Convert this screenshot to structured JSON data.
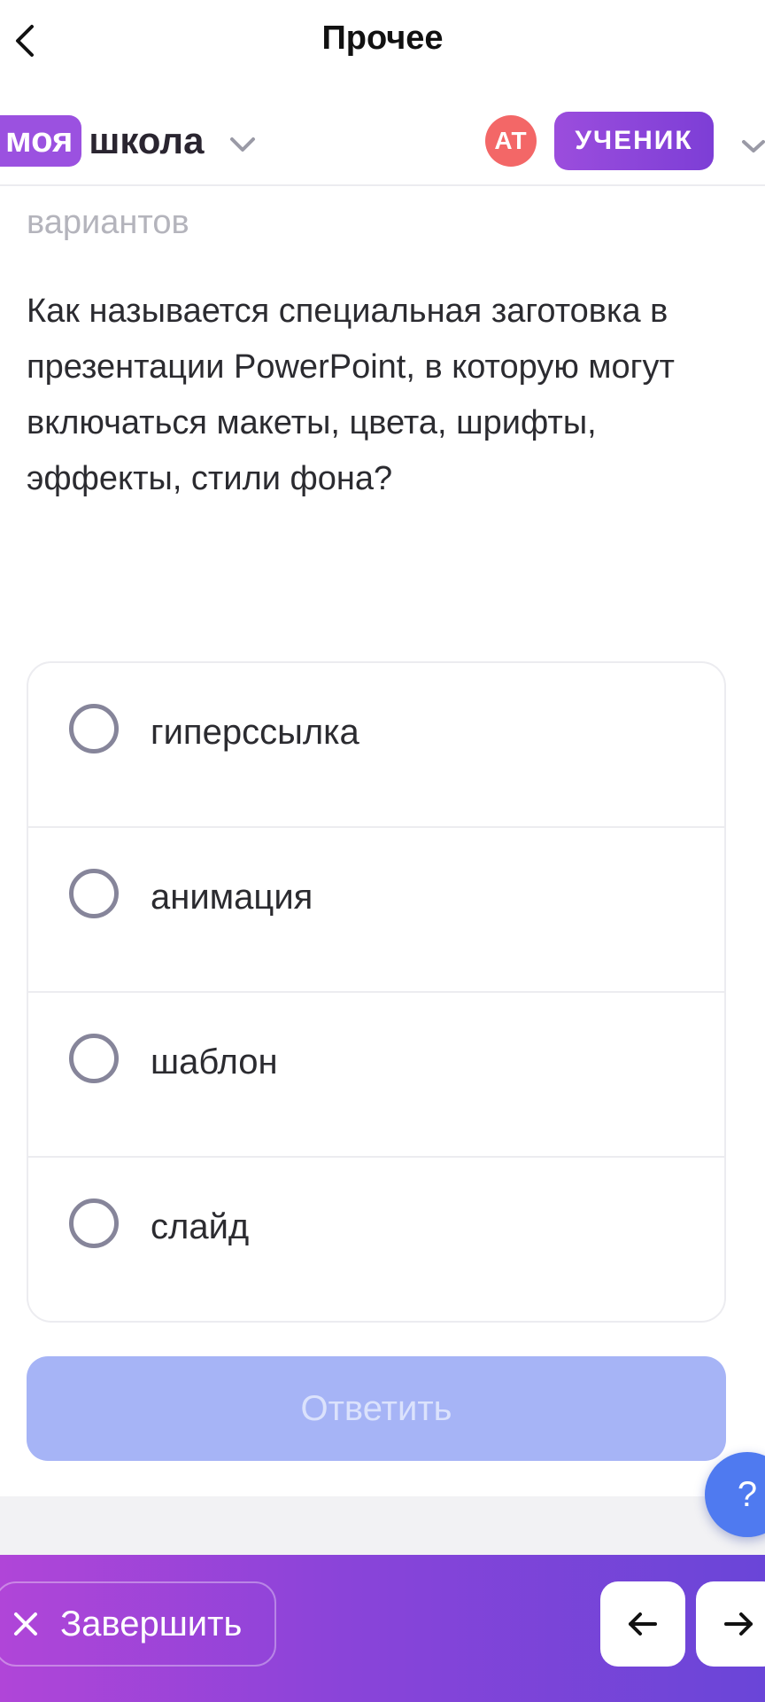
{
  "topbar": {
    "title": "Прочее"
  },
  "header": {
    "brand_pill": "моя",
    "brand_text": "школа",
    "avatar_initials": "AT",
    "role": "УЧЕНИК"
  },
  "content": {
    "hint": "вариантов",
    "question": "Как называется специальная заготовка в презентации PowerPoint, в которую могут включаться макеты, цвета, шрифты, эффекты, стили фона?",
    "options": [
      {
        "label": "гиперссылка"
      },
      {
        "label": "анимация"
      },
      {
        "label": "шаблон"
      },
      {
        "label": "слайд"
      }
    ],
    "submit_label": "Ответить",
    "help_label": "?"
  },
  "bottombar": {
    "finish_label": "Завершить"
  },
  "colors": {
    "brand_purple": "#9b51e0",
    "avatar_red": "#f36767",
    "submit_disabled": "#a6b4f6",
    "help_blue": "#4f7af0"
  },
  "icons": [
    "chevron-left-icon",
    "chevron-down-icon",
    "close-icon",
    "arrow-left-icon",
    "arrow-right-icon"
  ]
}
